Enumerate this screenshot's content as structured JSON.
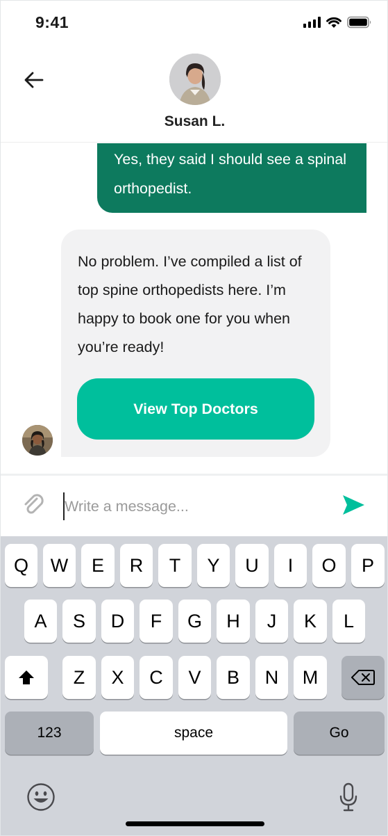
{
  "status_bar": {
    "time": "9:41",
    "icons": [
      "cellular-signal-icon",
      "wifi-icon",
      "battery-icon"
    ]
  },
  "header": {
    "back_icon": "arrow-left-icon",
    "contact_name": "Susan L."
  },
  "messages": [
    {
      "direction": "outgoing",
      "text": "Yes, they said I should see a spinal orthopedist."
    },
    {
      "direction": "incoming",
      "text": "No problem. I’ve compiled a list of top spine orthopedists here. I’m happy to book one for you when you’re ready!",
      "button_label": "View Top Doctors"
    }
  ],
  "composer": {
    "placeholder": "Write a message...",
    "value": "",
    "attach_icon": "paperclip-icon",
    "send_icon": "send-icon"
  },
  "keyboard": {
    "row1": [
      "Q",
      "W",
      "E",
      "R",
      "T",
      "Y",
      "U",
      "I",
      "O",
      "P"
    ],
    "row2": [
      "A",
      "S",
      "D",
      "F",
      "G",
      "H",
      "J",
      "K",
      "L"
    ],
    "row3": [
      "Z",
      "X",
      "C",
      "V",
      "B",
      "N",
      "M"
    ],
    "shift_icon": "shift-icon",
    "delete_icon": "backspace-icon",
    "numbers_label": "123",
    "space_label": "space",
    "go_label": "Go",
    "emoji_icon": "emoji-icon",
    "mic_icon": "microphone-icon"
  },
  "colors": {
    "outgoing_bubble": "#0d7a5e",
    "cta_button": "#00bf9c",
    "send_icon": "#00bf9c",
    "incoming_bubble": "#f2f2f3",
    "keyboard_bg": "#d1d4da"
  }
}
